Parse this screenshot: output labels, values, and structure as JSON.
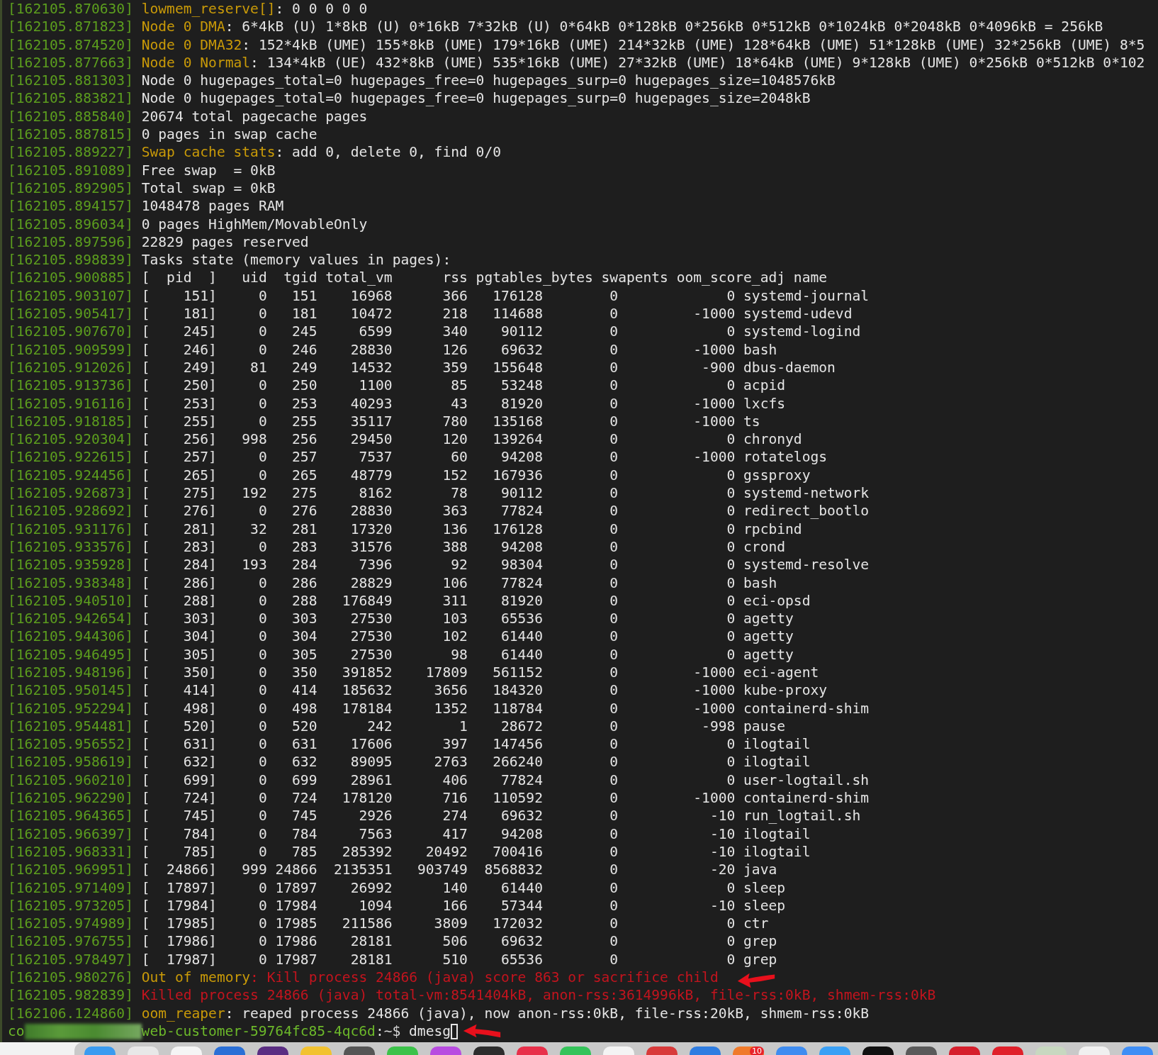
{
  "lines": [
    {
      "timestamp": "[162105.870630]",
      "kind": "text",
      "segments": [
        {
          "text": "lowmem_reserve[]",
          "kind": "label"
        },
        {
          "text": ": 0 0 0 0 0",
          "kind": "plain"
        }
      ]
    },
    {
      "timestamp": "[162105.871823]",
      "kind": "text",
      "segments": [
        {
          "text": "Node 0 DMA",
          "kind": "label"
        },
        {
          "text": ": 6*4kB (U) 1*8kB (U) 0*16kB 7*32kB (U) 0*64kB 0*128kB 0*256kB 0*512kB 0*1024kB 0*2048kB 0*4096kB = 256kB",
          "kind": "plain"
        }
      ]
    },
    {
      "timestamp": "[162105.874520]",
      "kind": "text",
      "segments": [
        {
          "text": "Node 0 DMA32",
          "kind": "label"
        },
        {
          "text": ": 152*4kB (UME) 155*8kB (UME) 179*16kB (UME) 214*32kB (UME) 128*64kB (UME) 51*128kB (UME) 32*256kB (UME) 8*5",
          "kind": "plain"
        }
      ]
    },
    {
      "timestamp": "[162105.877663]",
      "kind": "text",
      "segments": [
        {
          "text": "Node 0 Normal",
          "kind": "label"
        },
        {
          "text": ": 134*4kB (UE) 432*8kB (UME) 535*16kB (UME) 27*32kB (UME) 18*64kB (UME) 9*128kB (UME) 0*256kB 0*512kB 0*102",
          "kind": "plain"
        }
      ]
    },
    {
      "timestamp": "[162105.881303]",
      "kind": "text",
      "segments": [
        {
          "text": "Node 0 hugepages_total=0 hugepages_free=0 hugepages_surp=0 hugepages_size=1048576kB",
          "kind": "plain"
        }
      ]
    },
    {
      "timestamp": "[162105.883821]",
      "kind": "text",
      "segments": [
        {
          "text": "Node 0 hugepages_total=0 hugepages_free=0 hugepages_surp=0 hugepages_size=2048kB",
          "kind": "plain"
        }
      ]
    },
    {
      "timestamp": "[162105.885840]",
      "kind": "text",
      "segments": [
        {
          "text": "20674 total pagecache pages",
          "kind": "plain"
        }
      ]
    },
    {
      "timestamp": "[162105.887815]",
      "kind": "text",
      "segments": [
        {
          "text": "0 pages in swap cache",
          "kind": "plain"
        }
      ]
    },
    {
      "timestamp": "[162105.889227]",
      "kind": "text",
      "segments": [
        {
          "text": "Swap cache stats",
          "kind": "label"
        },
        {
          "text": ": add 0, delete 0, find 0/0",
          "kind": "plain"
        }
      ]
    },
    {
      "timestamp": "[162105.891089]",
      "kind": "text",
      "segments": [
        {
          "text": "Free swap  = 0kB",
          "kind": "plain"
        }
      ]
    },
    {
      "timestamp": "[162105.892905]",
      "kind": "text",
      "segments": [
        {
          "text": "Total swap = 0kB",
          "kind": "plain"
        }
      ]
    },
    {
      "timestamp": "[162105.894157]",
      "kind": "text",
      "segments": [
        {
          "text": "1048478 pages RAM",
          "kind": "plain"
        }
      ]
    },
    {
      "timestamp": "[162105.896034]",
      "kind": "text",
      "segments": [
        {
          "text": "0 pages HighMem/MovableOnly",
          "kind": "plain"
        }
      ]
    },
    {
      "timestamp": "[162105.897596]",
      "kind": "text",
      "segments": [
        {
          "text": "22829 pages reserved",
          "kind": "plain"
        }
      ]
    },
    {
      "timestamp": "[162105.898839]",
      "kind": "text",
      "segments": [
        {
          "text": "Tasks state (memory values in pages):",
          "kind": "plain"
        }
      ]
    },
    {
      "timestamp": "[162105.900885]",
      "kind": "header",
      "text": "[  pid  ]   uid  tgid total_vm      rss pgtables_bytes swapents oom_score_adj name"
    },
    {
      "timestamp": "[162105.903107]",
      "kind": "task",
      "cells": [
        "[    151]",
        "0",
        "151",
        "16968",
        "366",
        "176128",
        "0",
        "0",
        "systemd-journal"
      ]
    },
    {
      "timestamp": "[162105.905417]",
      "kind": "task",
      "cells": [
        "[    181]",
        "0",
        "181",
        "10472",
        "218",
        "114688",
        "0",
        "-1000",
        "systemd-udevd"
      ]
    },
    {
      "timestamp": "[162105.907670]",
      "kind": "task",
      "cells": [
        "[    245]",
        "0",
        "245",
        "6599",
        "340",
        "90112",
        "0",
        "0",
        "systemd-logind"
      ]
    },
    {
      "timestamp": "[162105.909599]",
      "kind": "task",
      "cells": [
        "[    246]",
        "0",
        "246",
        "28830",
        "126",
        "69632",
        "0",
        "-1000",
        "bash"
      ]
    },
    {
      "timestamp": "[162105.912026]",
      "kind": "task",
      "cells": [
        "[    249]",
        "81",
        "249",
        "14532",
        "359",
        "155648",
        "0",
        "-900",
        "dbus-daemon"
      ]
    },
    {
      "timestamp": "[162105.913736]",
      "kind": "task",
      "cells": [
        "[    250]",
        "0",
        "250",
        "1100",
        "85",
        "53248",
        "0",
        "0",
        "acpid"
      ]
    },
    {
      "timestamp": "[162105.916116]",
      "kind": "task",
      "cells": [
        "[    253]",
        "0",
        "253",
        "40293",
        "43",
        "81920",
        "0",
        "-1000",
        "lxcfs"
      ]
    },
    {
      "timestamp": "[162105.918185]",
      "kind": "task",
      "cells": [
        "[    255]",
        "0",
        "255",
        "35117",
        "780",
        "135168",
        "0",
        "-1000",
        "ts"
      ]
    },
    {
      "timestamp": "[162105.920304]",
      "kind": "task",
      "cells": [
        "[    256]",
        "998",
        "256",
        "29450",
        "120",
        "139264",
        "0",
        "0",
        "chronyd"
      ]
    },
    {
      "timestamp": "[162105.922615]",
      "kind": "task",
      "cells": [
        "[    257]",
        "0",
        "257",
        "7537",
        "60",
        "94208",
        "0",
        "-1000",
        "rotatelogs"
      ]
    },
    {
      "timestamp": "[162105.924456]",
      "kind": "task",
      "cells": [
        "[    265]",
        "0",
        "265",
        "48779",
        "152",
        "167936",
        "0",
        "0",
        "gssproxy"
      ]
    },
    {
      "timestamp": "[162105.926873]",
      "kind": "task",
      "cells": [
        "[    275]",
        "192",
        "275",
        "8162",
        "78",
        "90112",
        "0",
        "0",
        "systemd-network"
      ]
    },
    {
      "timestamp": "[162105.928692]",
      "kind": "task",
      "cells": [
        "[    276]",
        "0",
        "276",
        "28830",
        "363",
        "77824",
        "0",
        "0",
        "redirect_bootlo"
      ]
    },
    {
      "timestamp": "[162105.931176]",
      "kind": "task",
      "cells": [
        "[    281]",
        "32",
        "281",
        "17320",
        "136",
        "176128",
        "0",
        "0",
        "rpcbind"
      ]
    },
    {
      "timestamp": "[162105.933576]",
      "kind": "task",
      "cells": [
        "[    283]",
        "0",
        "283",
        "31576",
        "388",
        "94208",
        "0",
        "0",
        "crond"
      ]
    },
    {
      "timestamp": "[162105.935928]",
      "kind": "task",
      "cells": [
        "[    284]",
        "193",
        "284",
        "7396",
        "92",
        "98304",
        "0",
        "0",
        "systemd-resolve"
      ]
    },
    {
      "timestamp": "[162105.938348]",
      "kind": "task",
      "cells": [
        "[    286]",
        "0",
        "286",
        "28829",
        "106",
        "77824",
        "0",
        "0",
        "bash"
      ]
    },
    {
      "timestamp": "[162105.940510]",
      "kind": "task",
      "cells": [
        "[    288]",
        "0",
        "288",
        "176849",
        "311",
        "81920",
        "0",
        "0",
        "eci-opsd"
      ]
    },
    {
      "timestamp": "[162105.942654]",
      "kind": "task",
      "cells": [
        "[    303]",
        "0",
        "303",
        "27530",
        "103",
        "65536",
        "0",
        "0",
        "agetty"
      ]
    },
    {
      "timestamp": "[162105.944306]",
      "kind": "task",
      "cells": [
        "[    304]",
        "0",
        "304",
        "27530",
        "102",
        "61440",
        "0",
        "0",
        "agetty"
      ]
    },
    {
      "timestamp": "[162105.946495]",
      "kind": "task",
      "cells": [
        "[    305]",
        "0",
        "305",
        "27530",
        "98",
        "61440",
        "0",
        "0",
        "agetty"
      ]
    },
    {
      "timestamp": "[162105.948196]",
      "kind": "task",
      "cells": [
        "[    350]",
        "0",
        "350",
        "391852",
        "17809",
        "561152",
        "0",
        "-1000",
        "eci-agent"
      ]
    },
    {
      "timestamp": "[162105.950145]",
      "kind": "task",
      "cells": [
        "[    414]",
        "0",
        "414",
        "185632",
        "3656",
        "184320",
        "0",
        "-1000",
        "kube-proxy"
      ]
    },
    {
      "timestamp": "[162105.952294]",
      "kind": "task",
      "cells": [
        "[    498]",
        "0",
        "498",
        "178184",
        "1352",
        "118784",
        "0",
        "-1000",
        "containerd-shim"
      ]
    },
    {
      "timestamp": "[162105.954481]",
      "kind": "task",
      "cells": [
        "[    520]",
        "0",
        "520",
        "242",
        "1",
        "28672",
        "0",
        "-998",
        "pause"
      ]
    },
    {
      "timestamp": "[162105.956552]",
      "kind": "task",
      "cells": [
        "[    631]",
        "0",
        "631",
        "17606",
        "397",
        "147456",
        "0",
        "0",
        "ilogtail"
      ]
    },
    {
      "timestamp": "[162105.958619]",
      "kind": "task",
      "cells": [
        "[    632]",
        "0",
        "632",
        "89095",
        "2763",
        "266240",
        "0",
        "0",
        "ilogtail"
      ]
    },
    {
      "timestamp": "[162105.960210]",
      "kind": "task",
      "cells": [
        "[    699]",
        "0",
        "699",
        "28961",
        "406",
        "77824",
        "0",
        "0",
        "user-logtail.sh"
      ]
    },
    {
      "timestamp": "[162105.962290]",
      "kind": "task",
      "cells": [
        "[    724]",
        "0",
        "724",
        "178120",
        "716",
        "110592",
        "0",
        "-1000",
        "containerd-shim"
      ]
    },
    {
      "timestamp": "[162105.964365]",
      "kind": "task",
      "cells": [
        "[    745]",
        "0",
        "745",
        "2926",
        "274",
        "69632",
        "0",
        "-10",
        "run_logtail.sh"
      ]
    },
    {
      "timestamp": "[162105.966397]",
      "kind": "task",
      "cells": [
        "[    784]",
        "0",
        "784",
        "7563",
        "417",
        "94208",
        "0",
        "-10",
        "ilogtail"
      ]
    },
    {
      "timestamp": "[162105.968331]",
      "kind": "task",
      "cells": [
        "[    785]",
        "0",
        "785",
        "285392",
        "20492",
        "700416",
        "0",
        "-10",
        "ilogtail"
      ]
    },
    {
      "timestamp": "[162105.969951]",
      "kind": "task",
      "cells": [
        "[  24866]",
        "999",
        "24866",
        "2135351",
        "903749",
        "8568832",
        "0",
        "-20",
        "java"
      ]
    },
    {
      "timestamp": "[162105.971409]",
      "kind": "task",
      "cells": [
        "[  17897]",
        "0",
        "17897",
        "26992",
        "140",
        "61440",
        "0",
        "0",
        "sleep"
      ]
    },
    {
      "timestamp": "[162105.973205]",
      "kind": "task",
      "cells": [
        "[  17984]",
        "0",
        "17984",
        "1094",
        "166",
        "57344",
        "0",
        "-10",
        "sleep"
      ]
    },
    {
      "timestamp": "[162105.974989]",
      "kind": "task",
      "cells": [
        "[  17985]",
        "0",
        "17985",
        "211586",
        "3809",
        "172032",
        "0",
        "0",
        "ctr"
      ]
    },
    {
      "timestamp": "[162105.976755]",
      "kind": "task",
      "cells": [
        "[  17986]",
        "0",
        "17986",
        "28181",
        "506",
        "69632",
        "0",
        "0",
        "grep"
      ]
    },
    {
      "timestamp": "[162105.978497]",
      "kind": "task",
      "cells": [
        "[  17987]",
        "0",
        "17987",
        "28181",
        "510",
        "65536",
        "0",
        "0",
        "grep"
      ]
    },
    {
      "timestamp": "[162105.980276]",
      "kind": "text",
      "segments": [
        {
          "text": "Out of memory",
          "kind": "label"
        },
        {
          "text": ": Kill process 24866 (java) score 863 or sacrifice child",
          "kind": "error"
        }
      ]
    },
    {
      "timestamp": "[162105.982839]",
      "kind": "text",
      "segments": [
        {
          "text": "Killed process 24866 (java) total-vm:8541404kB, anon-rss:3614996kB, file-rss:0kB, shmem-rss:0kB",
          "kind": "error"
        }
      ]
    },
    {
      "timestamp": "[162106.124860]",
      "kind": "text",
      "segments": [
        {
          "text": "oom_reaper",
          "kind": "label"
        },
        {
          "text": ": reaped process 24866 (java), now anon-rss:0kB, file-rss:20kB, shmem-rss:0kB",
          "kind": "plain"
        }
      ]
    }
  ],
  "prompt": {
    "segments": [
      {
        "text": "co",
        "kind": "host"
      },
      {
        "kind": "redacted"
      },
      {
        "text": "web-customer-59764fc85-4qc6d",
        "kind": "host"
      },
      {
        "text": ":~$",
        "kind": "path"
      }
    ],
    "command": "dmesg"
  },
  "dock": {
    "badge": "10"
  }
}
